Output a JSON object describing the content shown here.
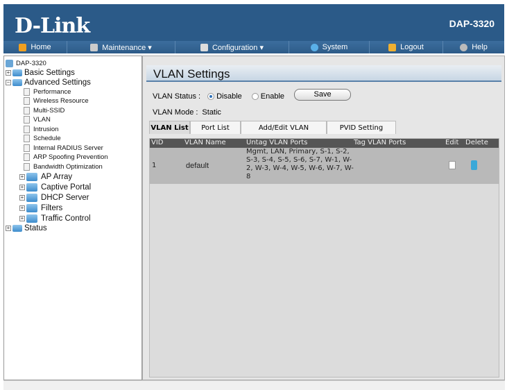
{
  "header": {
    "brand": "D-Link",
    "model": "DAP-3320"
  },
  "nav": [
    {
      "label": "Home",
      "icon": "home-icon"
    },
    {
      "label": "Maintenance ▾",
      "icon": "tools-icon"
    },
    {
      "label": "Configuration ▾",
      "icon": "floppy-icon"
    },
    {
      "label": "System",
      "icon": "globe-icon"
    },
    {
      "label": "Logout",
      "icon": "logout-icon"
    },
    {
      "label": "Help",
      "icon": "help-icon"
    }
  ],
  "tree": {
    "root": "DAP-3320",
    "basic": "Basic Settings",
    "advanced": "Advanced Settings",
    "pages": [
      "Performance",
      "Wireless Resource",
      "Multi-SSID",
      "VLAN",
      "Intrusion",
      "Schedule",
      "Internal RADIUS Server",
      "ARP Spoofing Prevention",
      "Bandwidth Optimization"
    ],
    "folders": [
      "AP Array",
      "Captive Portal",
      "DHCP Server",
      "Filters",
      "Traffic Control"
    ],
    "status": "Status"
  },
  "main": {
    "title": "VLAN Settings",
    "status_label": "VLAN Status :",
    "disable": "Disable",
    "enable": "Enable",
    "selected": "Disable",
    "save": "Save",
    "mode_label": "VLAN Mode :",
    "mode_value": "Static",
    "tabs": [
      "VLAN List",
      "Port List",
      "Add/Edit VLAN",
      "PVID Setting"
    ],
    "columns": [
      "VID",
      "VLAN Name",
      "Untag VLAN Ports",
      "Tag VLAN Ports",
      "Edit",
      "Delete"
    ],
    "rows": [
      {
        "vid": "1",
        "name": "default",
        "untag": "Mgmt, LAN, Primary, S-1, S-2, S-3, S-4, S-5, S-6, S-7, W-1, W-2, W-3, W-4, W-5, W-6, W-7, W-8",
        "tag": ""
      }
    ]
  }
}
